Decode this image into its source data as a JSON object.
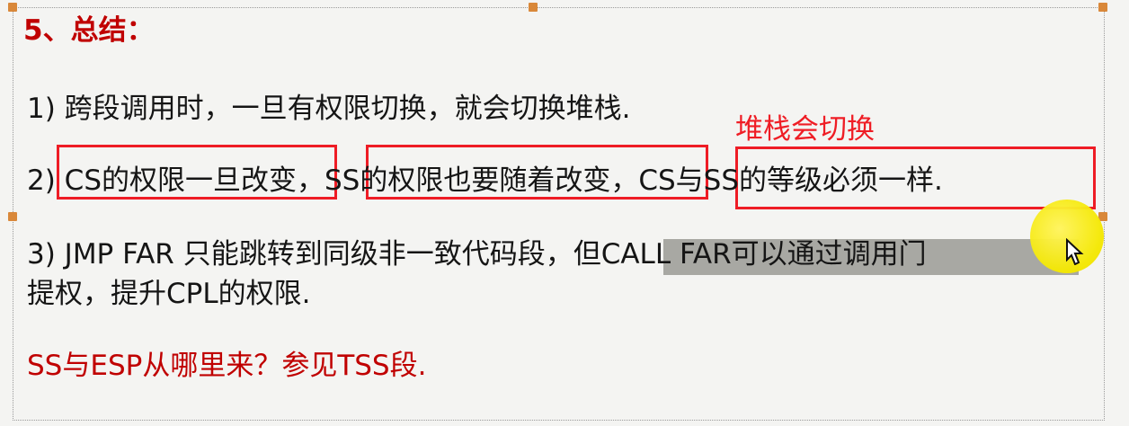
{
  "slide": {
    "title": "5、总结：",
    "line1": "1) 跨段调用时，一旦有权限切换，就会切换堆栈.",
    "line2": {
      "prefix": "2) ",
      "part1": "CS的权限一旦改变",
      "sep1": "，",
      "part2": "SS的权限也要随着改变",
      "sep2": "，",
      "part3": "CS与SS的等级必须一样",
      "suffix": "."
    },
    "annotation": "堆栈会切换",
    "line3": {
      "part1": "3) JMP FAR 只能跳转到同级非一致代码段，",
      "highlighted": "但CALL FAR可以通过调用门",
      "continuation": "提权，提升CPL的权限."
    },
    "footer": "SS与ESP从哪里来？参见TSS段."
  },
  "colors": {
    "accent_red": "#c00000",
    "box_red": "#ee1c25",
    "highlight_gray": "#a8a8a3",
    "cursor_yellow": "#f4e800"
  },
  "icons": {
    "cursor": "mouse-cursor-icon"
  }
}
